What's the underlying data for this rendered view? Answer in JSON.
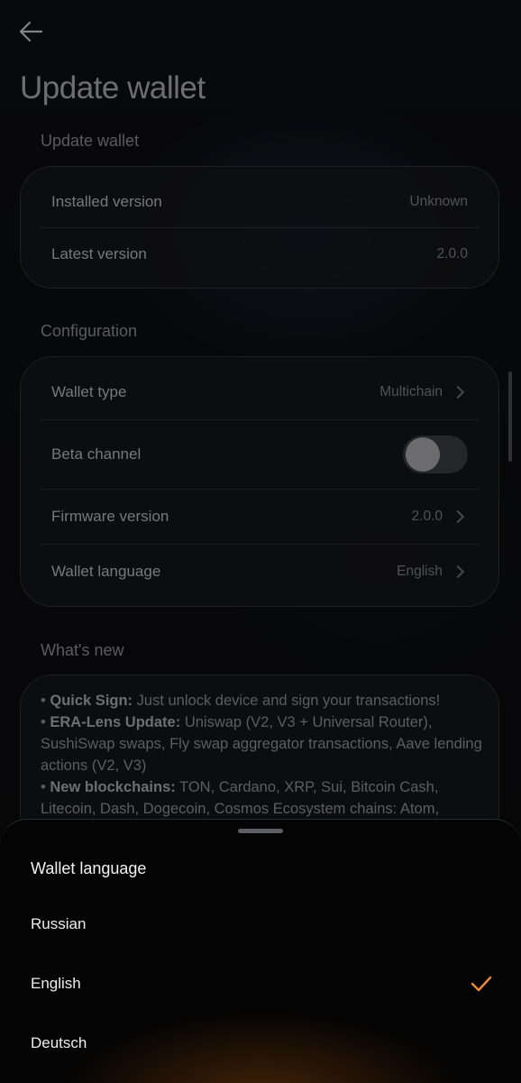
{
  "header": {
    "title": "Update wallet",
    "back_icon": "arrow-left-icon"
  },
  "update_section": {
    "label": "Update wallet",
    "rows": [
      {
        "label": "Installed version",
        "value": "Unknown"
      },
      {
        "label": "Latest version",
        "value": "2.0.0"
      }
    ]
  },
  "configuration": {
    "label": "Configuration",
    "wallet_type": {
      "label": "Wallet type",
      "value": "Multichain"
    },
    "beta_channel": {
      "label": "Beta channel",
      "enabled": false
    },
    "firmware_version": {
      "label": "Firmware version",
      "value": "2.0.0"
    },
    "wallet_language": {
      "label": "Wallet language",
      "value": "English"
    }
  },
  "whats_new": {
    "label": "What's new",
    "items": [
      {
        "bullet": "•",
        "title": "Quick Sign:",
        "text": "Just unlock device and sign your transactions!"
      },
      {
        "bullet": "•",
        "title": "ERA-Lens Update:",
        "text": "Uniswap (V2, V3 + Universal Router), SushiSwap swaps, Fly swap aggregator transactions, Aave lending actions (V2, V3)"
      },
      {
        "bullet": "•",
        "title": "New blockchains:",
        "text": "TON, Cardano, XRP, Sui, Bitcoin Cash, Litecoin, Dash, Dogecoin, Cosmos Ecosystem chains: Atom, ThorChain,"
      }
    ]
  },
  "language_sheet": {
    "title": "Wallet language",
    "options": [
      {
        "label": "Russian",
        "selected": false
      },
      {
        "label": "English",
        "selected": true
      },
      {
        "label": "Deutsch",
        "selected": false
      }
    ],
    "check_color": "#f0883a"
  },
  "colors": {
    "background": "#0b0b0e",
    "accent": "#f0883a"
  }
}
